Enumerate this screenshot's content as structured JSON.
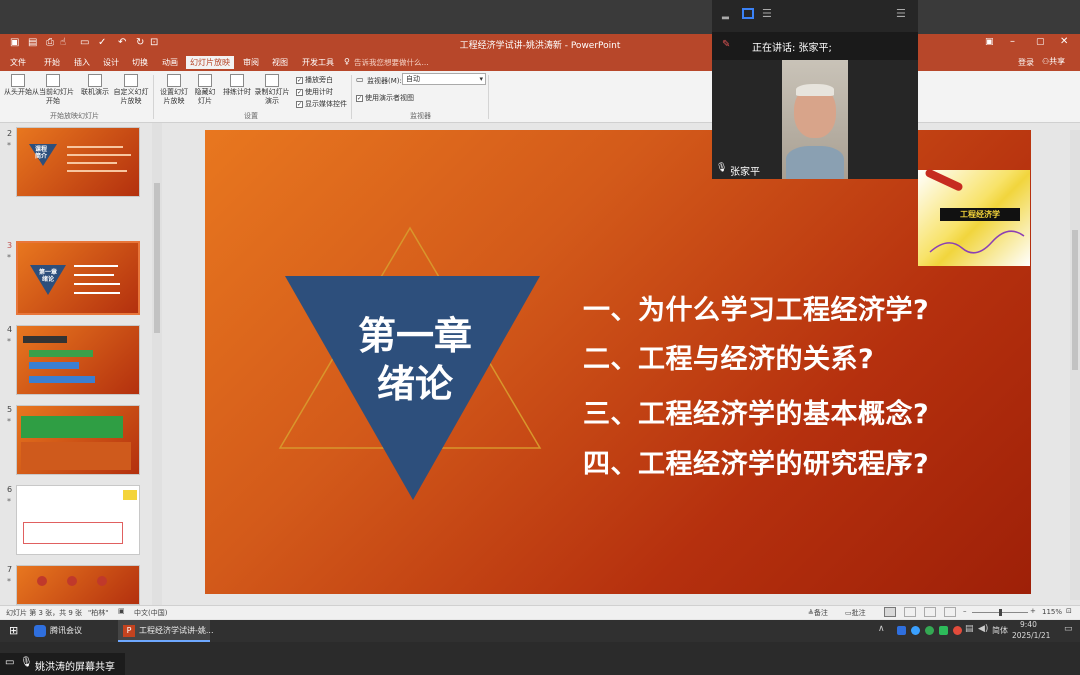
{
  "window": {
    "title": "工程经济学试讲-姚洪涛新 - PowerPoint",
    "login": "登录",
    "share": "共享"
  },
  "menu": {
    "items": [
      "文件",
      "开始",
      "插入",
      "设计",
      "切换",
      "动画",
      "幻灯片放映",
      "审阅",
      "视图",
      "开发工具"
    ],
    "active_index": 6,
    "search_placeholder": "告诉我您想要做什么..."
  },
  "ribbon": {
    "buttons": [
      "从头开始",
      "从当前幻灯片开始",
      "联机演示",
      "自定义幻灯片放映",
      "设置幻灯片放映",
      "隐藏幻灯片",
      "排练计时",
      "录制幻灯片演示"
    ],
    "checkboxes": [
      "播放旁白",
      "使用计时",
      "显示媒体控件"
    ],
    "monitor_label": "监视器(M):",
    "monitor_value": "自动",
    "presenter_view": "使用演示者视图",
    "groups": [
      "开始放映幻灯片",
      "设置",
      "监视器"
    ]
  },
  "thumbnails": [
    {
      "num": "2",
      "title": "课程简介"
    },
    {
      "num": "3",
      "title": "第一章绪论",
      "selected": true
    },
    {
      "num": "4",
      "title": ""
    },
    {
      "num": "5",
      "title": ""
    },
    {
      "num": "6",
      "title": ""
    },
    {
      "num": "7",
      "title": ""
    }
  ],
  "slide": {
    "chapter": "第一章",
    "subtitle": "绪论",
    "questions": [
      "一、为什么学习工程经济学?",
      "二、工程与经济的关系?",
      "三、工程经济学的基本概念?",
      "四、工程经济学的研究程序?"
    ],
    "badge": "工程经济学"
  },
  "status": {
    "slide_info": "幻灯片 第 3 张，共 9 张",
    "theme": "\"柏林\"",
    "language": "中文(中国)",
    "notes": "备注",
    "comments": "批注",
    "zoom": "115%"
  },
  "meeting": {
    "speaking": "正在讲话: 张家平;",
    "participant": "张家平"
  },
  "taskbar": {
    "app1": "腾讯会议",
    "app2": "工程经济学试讲-姚...",
    "ime": "简体",
    "time": "9:40",
    "date": "2025/1/21"
  },
  "sharebar": {
    "label": "姚洪涛的屏幕共享"
  }
}
